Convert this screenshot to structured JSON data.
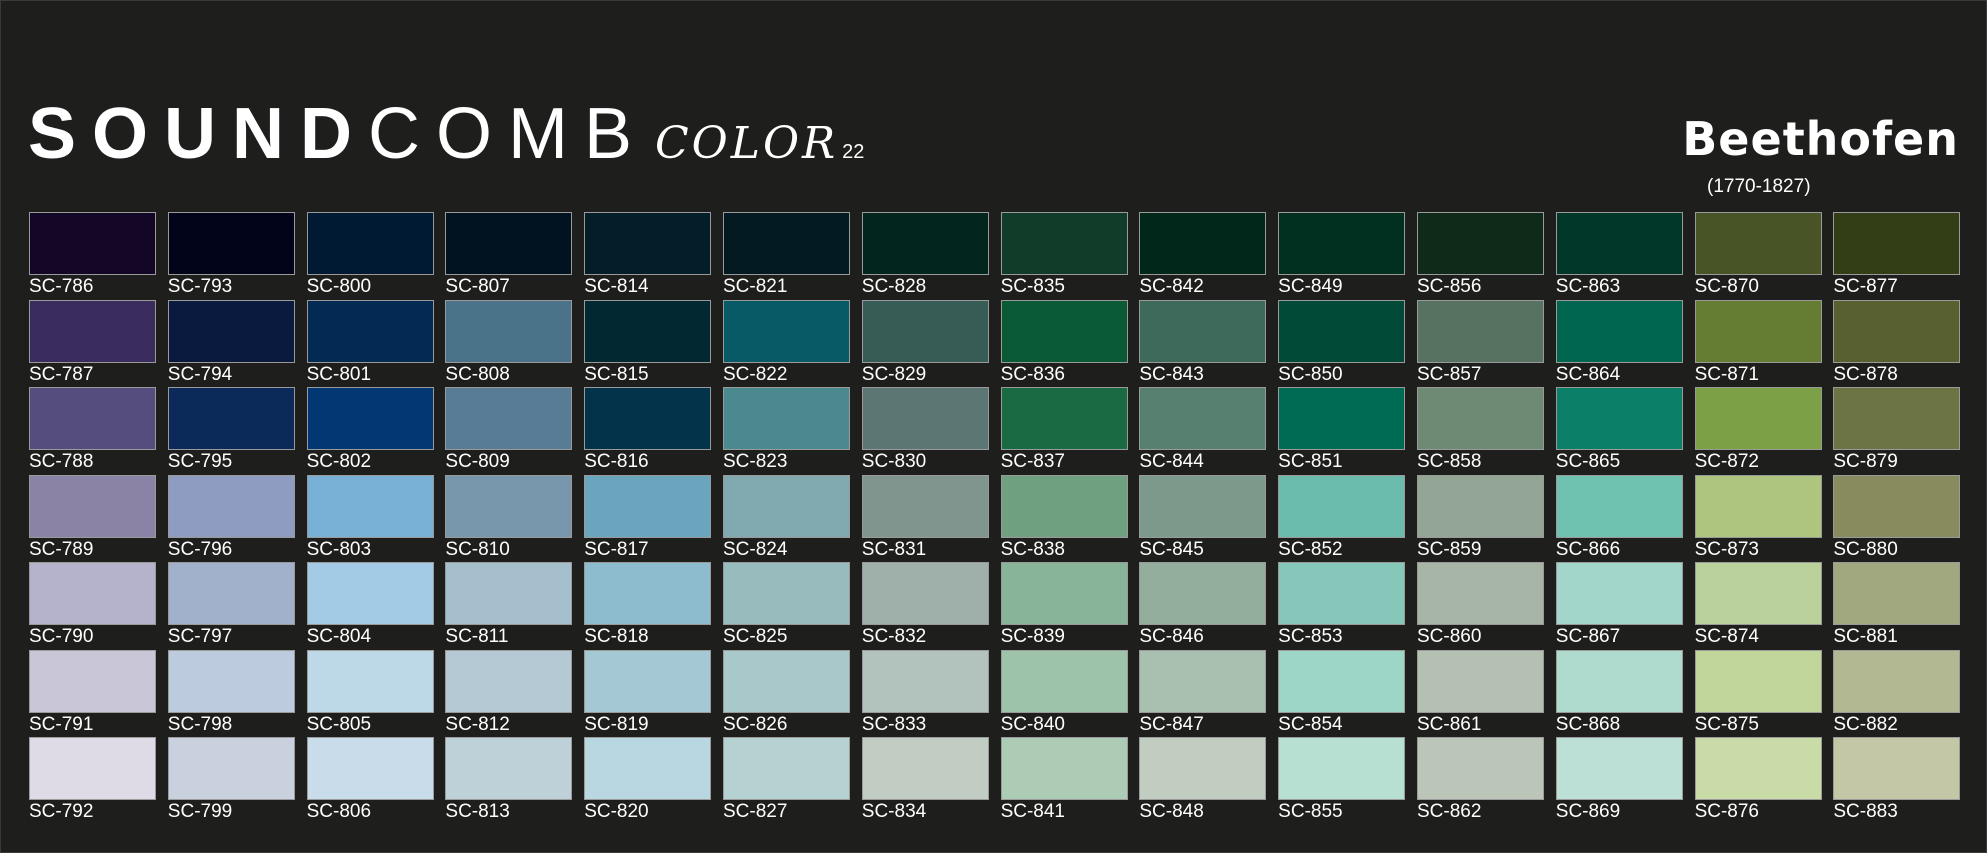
{
  "header": {
    "logo_bold": "SOUND",
    "logo_thin": "COMB",
    "line": "COLOR",
    "line_number": "22",
    "collection_name": "Beethofen",
    "collection_years": "(1770-1827)"
  },
  "columns": [
    {
      "codes": [
        "SC-786",
        "SC-787",
        "SC-788",
        "SC-789",
        "SC-790",
        "SC-791",
        "SC-792"
      ],
      "colors": [
        "#130627",
        "#3a2d5d",
        "#544d7d",
        "#8b83a6",
        "#b5b2cb",
        "#c8c6d7",
        "#dedbe7"
      ]
    },
    {
      "codes": [
        "SC-793",
        "SC-794",
        "SC-795",
        "SC-796",
        "SC-797",
        "SC-798",
        "SC-799"
      ],
      "colors": [
        "#020519",
        "#0a1a3e",
        "#0b2a5a",
        "#8e9cc2",
        "#a1b1cc",
        "#bccbdd",
        "#c9d1de"
      ]
    },
    {
      "codes": [
        "SC-800",
        "SC-801",
        "SC-802",
        "SC-803",
        "SC-804",
        "SC-805",
        "SC-806"
      ],
      "colors": [
        "#011a33",
        "#022a52",
        "#013873",
        "#79b0d6",
        "#a3cbe6",
        "#bdd8e6",
        "#c9dcea"
      ]
    },
    {
      "codes": [
        "SC-807",
        "SC-808",
        "SC-809",
        "SC-810",
        "SC-811",
        "SC-812",
        "SC-813"
      ],
      "colors": [
        "#011221",
        "#4a7288",
        "#587b96",
        "#7997ac",
        "#a6bfcd",
        "#b5c9d5",
        "#bed0d8"
      ]
    },
    {
      "codes": [
        "SC-814",
        "SC-815",
        "SC-816",
        "SC-817",
        "SC-818",
        "SC-819",
        "SC-820"
      ],
      "colors": [
        "#031e28",
        "#022832",
        "#02334a",
        "#69a6bd",
        "#8ebccf",
        "#a4c9d5",
        "#b9d7e0"
      ]
    },
    {
      "codes": [
        "SC-821",
        "SC-822",
        "SC-823",
        "SC-824",
        "SC-825",
        "SC-826",
        "SC-827"
      ],
      "colors": [
        "#031a22",
        "#085a66",
        "#4a8a8f",
        "#80a9b0",
        "#98bcbe",
        "#a9c8ca",
        "#b5d1d1"
      ]
    },
    {
      "codes": [
        "SC-828",
        "SC-829",
        "SC-830",
        "SC-831",
        "SC-832",
        "SC-833",
        "SC-834"
      ],
      "colors": [
        "#02251d",
        "#365c55",
        "#5b7673",
        "#81958f",
        "#9fb0ab",
        "#b1c3bc",
        "#c1ccc3"
      ]
    },
    {
      "codes": [
        "SC-835",
        "SC-836",
        "SC-837",
        "SC-838",
        "SC-839",
        "SC-840",
        "SC-841"
      ],
      "colors": [
        "#123c2a",
        "#0b5a36",
        "#1a6b44",
        "#6fa181",
        "#88b49a",
        "#9dc3ab",
        "#acccb6"
      ]
    },
    {
      "codes": [
        "SC-842",
        "SC-843",
        "SC-844",
        "SC-845",
        "SC-846",
        "SC-847",
        "SC-848"
      ],
      "colors": [
        "#01261a",
        "#3d6a5a",
        "#588070",
        "#7c9a8b",
        "#94ae9e",
        "#a9bfb0",
        "#c0cdc0"
      ]
    },
    {
      "codes": [
        "SC-849",
        "SC-850",
        "SC-851",
        "SC-852",
        "SC-853",
        "SC-854",
        "SC-855"
      ],
      "colors": [
        "#013020",
        "#004a37",
        "#006b55",
        "#6bbcad",
        "#85c7b9",
        "#9dd6c6",
        "#b7e0d2"
      ]
    },
    {
      "codes": [
        "SC-856",
        "SC-857",
        "SC-858",
        "SC-859",
        "SC-860",
        "SC-861",
        "SC-862"
      ],
      "colors": [
        "#0f2a19",
        "#577260",
        "#6f8a74",
        "#93a696",
        "#a6b5a5",
        "#b4c0b2",
        "#bcc6b8"
      ]
    },
    {
      "codes": [
        "SC-863",
        "SC-864",
        "SC-865",
        "SC-866",
        "SC-867",
        "SC-868",
        "SC-869"
      ],
      "colors": [
        "#013728",
        "#01664f",
        "#0b7f68",
        "#70c2b0",
        "#a3d6cb",
        "#afdbcf",
        "#bde0d6"
      ]
    },
    {
      "codes": [
        "SC-870",
        "SC-871",
        "SC-872",
        "SC-873",
        "SC-874",
        "SC-875",
        "SC-876"
      ],
      "colors": [
        "#485425",
        "#647d33",
        "#7ba045",
        "#adc57e",
        "#bad19b",
        "#c0d69b",
        "#c9dba6"
      ]
    },
    {
      "codes": [
        "SC-877",
        "SC-878",
        "SC-879",
        "SC-880",
        "SC-881",
        "SC-882",
        "SC-883"
      ],
      "colors": [
        "#333e17",
        "#58602f",
        "#6d7444",
        "#888b5d",
        "#a1a87f",
        "#b2b891",
        "#c4c7a6"
      ]
    }
  ]
}
